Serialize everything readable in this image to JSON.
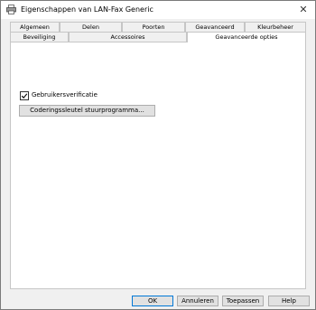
{
  "window": {
    "title": "Eigenschappen van LAN-Fax Generic",
    "close_symbol": "✕"
  },
  "tabs": {
    "row_back": [
      "Algemeen",
      "Delen",
      "Poorten",
      "Geavanceerd",
      "Kleurbeheer"
    ],
    "row_front": [
      "Beveiliging",
      "Accessoires",
      "Geavanceerde opties"
    ],
    "active": "Geavanceerde opties"
  },
  "options": {
    "user_verification_label": "Gebruikersverificatie",
    "user_verification_checked": true,
    "encryption_key_button": "Coderingssleutel stuurprogramma..."
  },
  "footer": {
    "ok": "OK",
    "cancel": "Annuleren",
    "apply": "Toepassen",
    "help": "Help"
  },
  "colors": {
    "accent": "#0078d7",
    "window_bg": "#f0f0f0",
    "panel_bg": "#ffffff"
  }
}
